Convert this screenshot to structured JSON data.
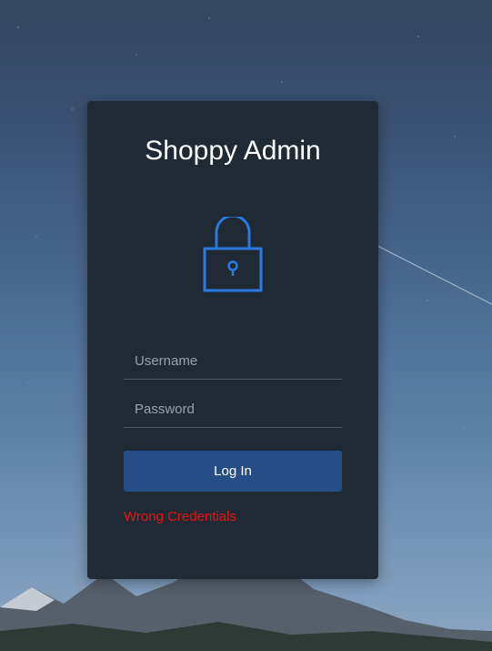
{
  "login": {
    "title": "Shoppy Admin",
    "username_placeholder": "Username",
    "password_placeholder": "Password",
    "login_button_label": "Log In",
    "error_message": "Wrong Credentials"
  },
  "icons": {
    "lock": "lock-icon"
  },
  "colors": {
    "card_background": "#1f2a35",
    "accent": "#2a7ae2",
    "button": "#244e85",
    "error": "#e81414"
  }
}
